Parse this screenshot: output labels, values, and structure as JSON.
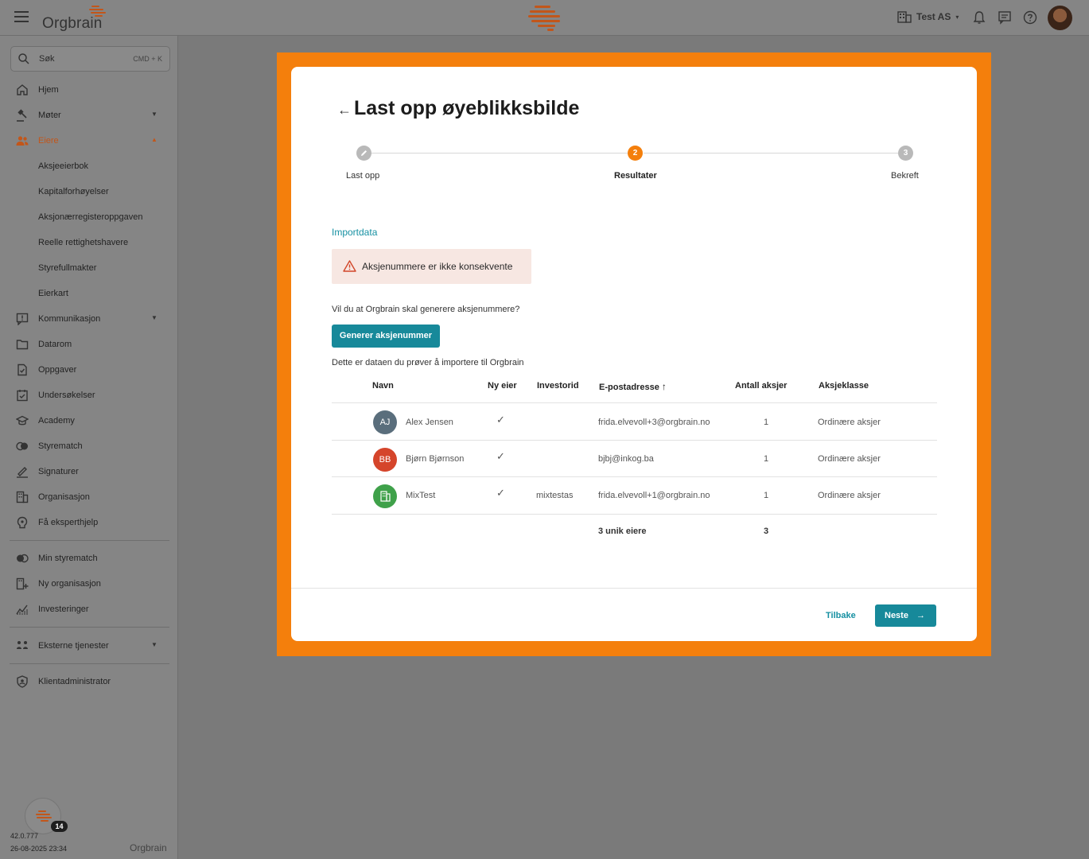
{
  "app": {
    "logo": "Orgbrain"
  },
  "topbar": {
    "company": "Test AS",
    "company_chevron": "▾"
  },
  "search": {
    "label": "Søk",
    "shortcut": "CMD + K"
  },
  "sidebar": {
    "items": [
      {
        "label": "Hjem"
      },
      {
        "label": "Møter"
      },
      {
        "label": "Eiere"
      },
      {
        "label": "Aksjeeierbok"
      },
      {
        "label": "Kapitalforhøyelser"
      },
      {
        "label": "Aksjonærregisteroppgaven"
      },
      {
        "label": "Reelle rettighetshavere"
      },
      {
        "label": "Styrefullmakter"
      },
      {
        "label": "Eierkart"
      },
      {
        "label": "Kommunikasjon"
      },
      {
        "label": "Datarom"
      },
      {
        "label": "Oppgaver"
      },
      {
        "label": "Undersøkelser"
      },
      {
        "label": "Academy"
      },
      {
        "label": "Styrematch"
      },
      {
        "label": "Signaturer"
      },
      {
        "label": "Organisasjon"
      },
      {
        "label": "Få eksperthjelp"
      },
      {
        "label": "Min styrematch"
      },
      {
        "label": "Ny organisasjon"
      },
      {
        "label": "Investeringer"
      },
      {
        "label": "Eksterne tjenester"
      },
      {
        "label": "Klientadministrator"
      }
    ],
    "badge_count": "14",
    "version": "42.0.777",
    "build_date": "26-08-2025 23:34",
    "footer_logo": "Orgbrain"
  },
  "modal": {
    "title": "Last opp øyeblikksbilde",
    "steps": [
      {
        "label": "Last opp",
        "number": ""
      },
      {
        "label": "Resultater",
        "number": "2"
      },
      {
        "label": "Bekreft",
        "number": "3"
      }
    ],
    "section_title": "Importdata",
    "alert": "Aksjenummere er ikke konsekvente",
    "question": "Vil du at Orgbrain skal generere aksjenummere?",
    "generate_button": "Generer aksjenummer",
    "description": "Dette er dataen du prøver å importere til Orgbrain",
    "table": {
      "headers": {
        "name": "Navn",
        "new_owner": "Ny eier",
        "investor_id": "Investorid",
        "email": "E-postadresse",
        "shares": "Antall aksjer",
        "share_class": "Aksjeklasse"
      },
      "rows": [
        {
          "initials": "AJ",
          "name": "Alex Jensen",
          "check": "✓",
          "investor_id": "",
          "email": "frida.elvevoll+3@orgbrain.no",
          "shares": "1",
          "share_class": "Ordinære aksjer"
        },
        {
          "initials": "BB",
          "name": "Bjørn Bjørnson",
          "check": "✓",
          "investor_id": "",
          "email": "bjbj@inkog.ba",
          "shares": "1",
          "share_class": "Ordinære aksjer"
        },
        {
          "initials": "",
          "name": "MixTest",
          "check": "✓",
          "investor_id": "mixtestas",
          "email": "frida.elvevoll+1@orgbrain.no",
          "shares": "1",
          "share_class": "Ordinære aksjer"
        }
      ],
      "totals": {
        "owners": "3 unik eiere",
        "shares": "3"
      }
    },
    "back_button": "Tilbake",
    "next_button": "Neste"
  },
  "colors": {
    "accent": "#17899a",
    "highlight": "#f47f0c",
    "active_step": "#f47f0c",
    "active_nav": "#c2561a"
  }
}
